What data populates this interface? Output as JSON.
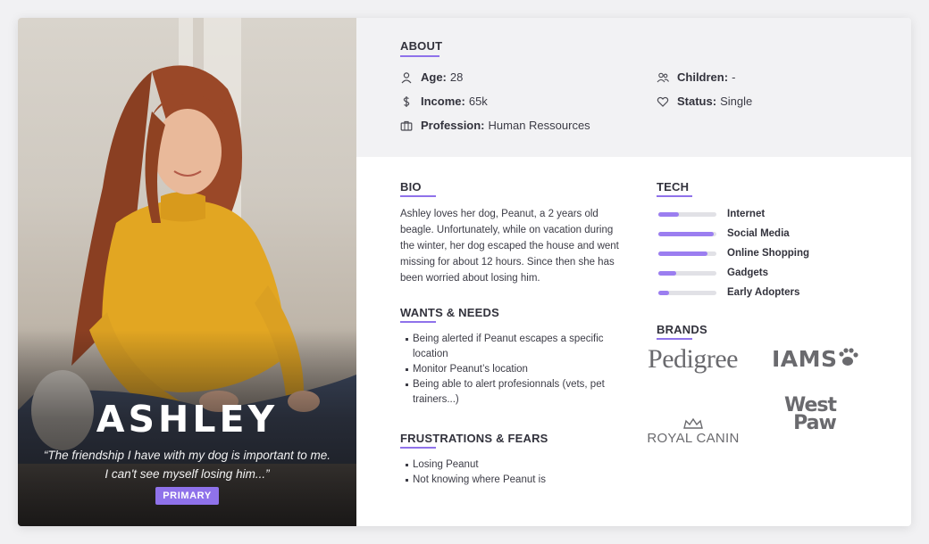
{
  "persona": {
    "name": "ASHLEY",
    "quote_line1": "“The friendship I have with my dog is important to me.",
    "quote_line2": "I can't see myself losing him...”",
    "badge": "PRIMARY"
  },
  "about": {
    "title": "ABOUT",
    "items": [
      {
        "label": "Age:",
        "value": "28",
        "icon": "person-icon"
      },
      {
        "label": "Income:",
        "value": "65k",
        "icon": "dollar-icon"
      },
      {
        "label": "Profession:",
        "value": "Human Ressources",
        "icon": "briefcase-icon"
      },
      {
        "label": "Children:",
        "value": "-",
        "icon": "people-icon"
      },
      {
        "label": "Status:",
        "value": "Single",
        "icon": "heart-icon"
      }
    ]
  },
  "bio": {
    "title": "BIO",
    "text": "Ashley loves her dog, Peanut, a 2 years old beagle. Unfortunately, while on vacation during the winter, her dog escaped the house and went missing for about 12 hours. Since then she has been worried about losing him."
  },
  "wants": {
    "title": "WANTS & NEEDS",
    "items": [
      "Being alerted if Peanut escapes a specific location",
      "Monitor Peanut’s location",
      "Being able to alert profesionnals (vets, pet trainers...)"
    ]
  },
  "frustrations": {
    "title": "FRUSTRATIONS & FEARS",
    "items": [
      "Losing Peanut",
      "Not knowing where Peanut is"
    ]
  },
  "tech": {
    "title": "TECH",
    "items": [
      {
        "label": "Internet",
        "level": 0.35
      },
      {
        "label": "Social Media",
        "level": 0.95
      },
      {
        "label": "Online Shopping",
        "level": 0.85
      },
      {
        "label": "Gadgets",
        "level": 0.3
      },
      {
        "label": "Early Adopters",
        "level": 0.18
      }
    ]
  },
  "brands": {
    "title": "BRANDS",
    "pedigree": "Pedigree",
    "iams": "IAMS",
    "royal_canin": "ROYAL CANIN",
    "west_paw_1": "West",
    "west_paw_2": "Paw"
  },
  "colors": {
    "accent": "#8f72ea",
    "about_bg": "#f2f2f4"
  }
}
